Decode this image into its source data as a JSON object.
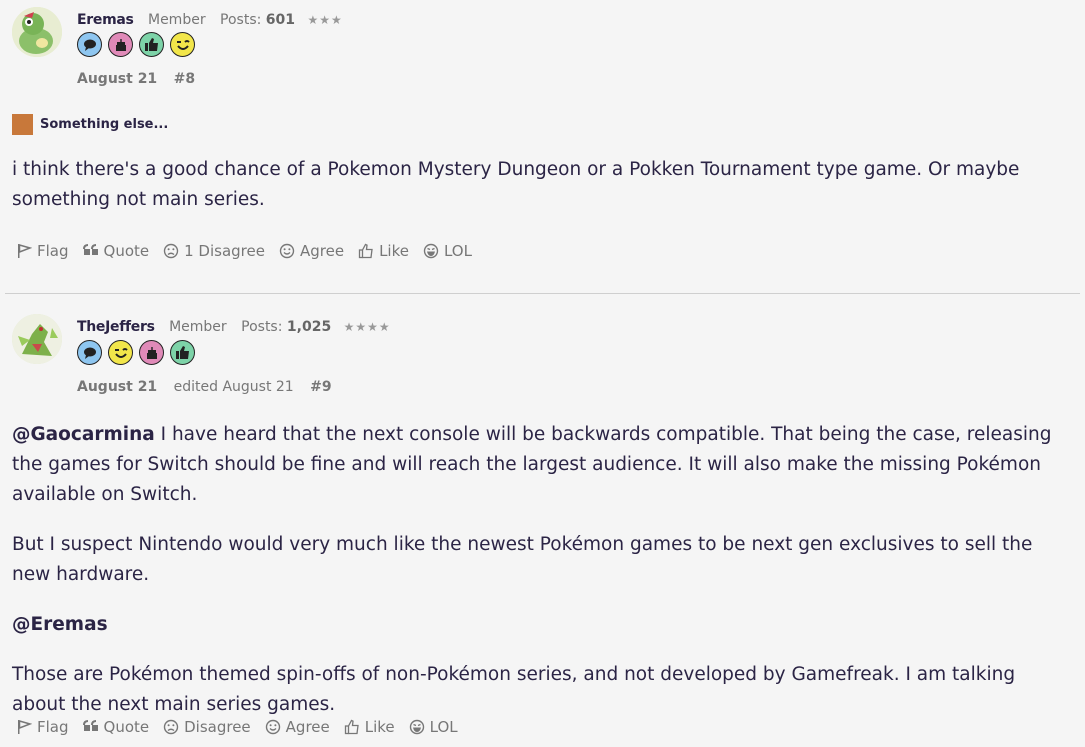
{
  "posts": [
    {
      "author": "Eremas",
      "role": "Member",
      "posts_label": "Posts:",
      "posts_count": "601",
      "stars": "★★★",
      "date": "August 21",
      "edited": "",
      "number": "#8",
      "spoiler_label": "Something else...",
      "paragraphs": [
        "i think there's a good chance of a Pokemon Mystery Dungeon or a Pokken Tournament type game. Or maybe something not main series."
      ],
      "actions": {
        "flag": "Flag",
        "quote": "Quote",
        "disagree": "1 Disagree",
        "agree": "Agree",
        "like": "Like",
        "lol": "LOL"
      }
    },
    {
      "author": "TheJeffers",
      "role": "Member",
      "posts_label": "Posts:",
      "posts_count": "1,025",
      "stars": "★★★★",
      "date": "August 21",
      "edited": "edited August 21",
      "number": "#9",
      "mention1": "@Gaocarmina",
      "paragraph1_rest": " I have heard that the next console will be backwards compatible. That being the case, releasing the games for Switch should be fine and will reach the largest audience. It will also make the missing Pokémon available on Switch.",
      "paragraph2": "But I suspect Nintendo would very much like the newest Pokémon games to be next gen exclusives to sell the new hardware.",
      "mention2": "@Eremas",
      "paragraph3": "Those are Pokémon themed spin-offs of non-Pokémon series, and not developed by Gamefreak. I am talking about the next main series games.",
      "actions": {
        "flag": "Flag",
        "quote": "Quote",
        "disagree": "Disagree",
        "agree": "Agree",
        "like": "Like",
        "lol": "LOL"
      }
    }
  ],
  "colors": {
    "badge_blue": "#8ec6f0",
    "badge_pink": "#e08ab8",
    "badge_green": "#7dd3a8",
    "badge_yellow": "#f2e64a",
    "spoiler_swatch": "#c8783a"
  }
}
